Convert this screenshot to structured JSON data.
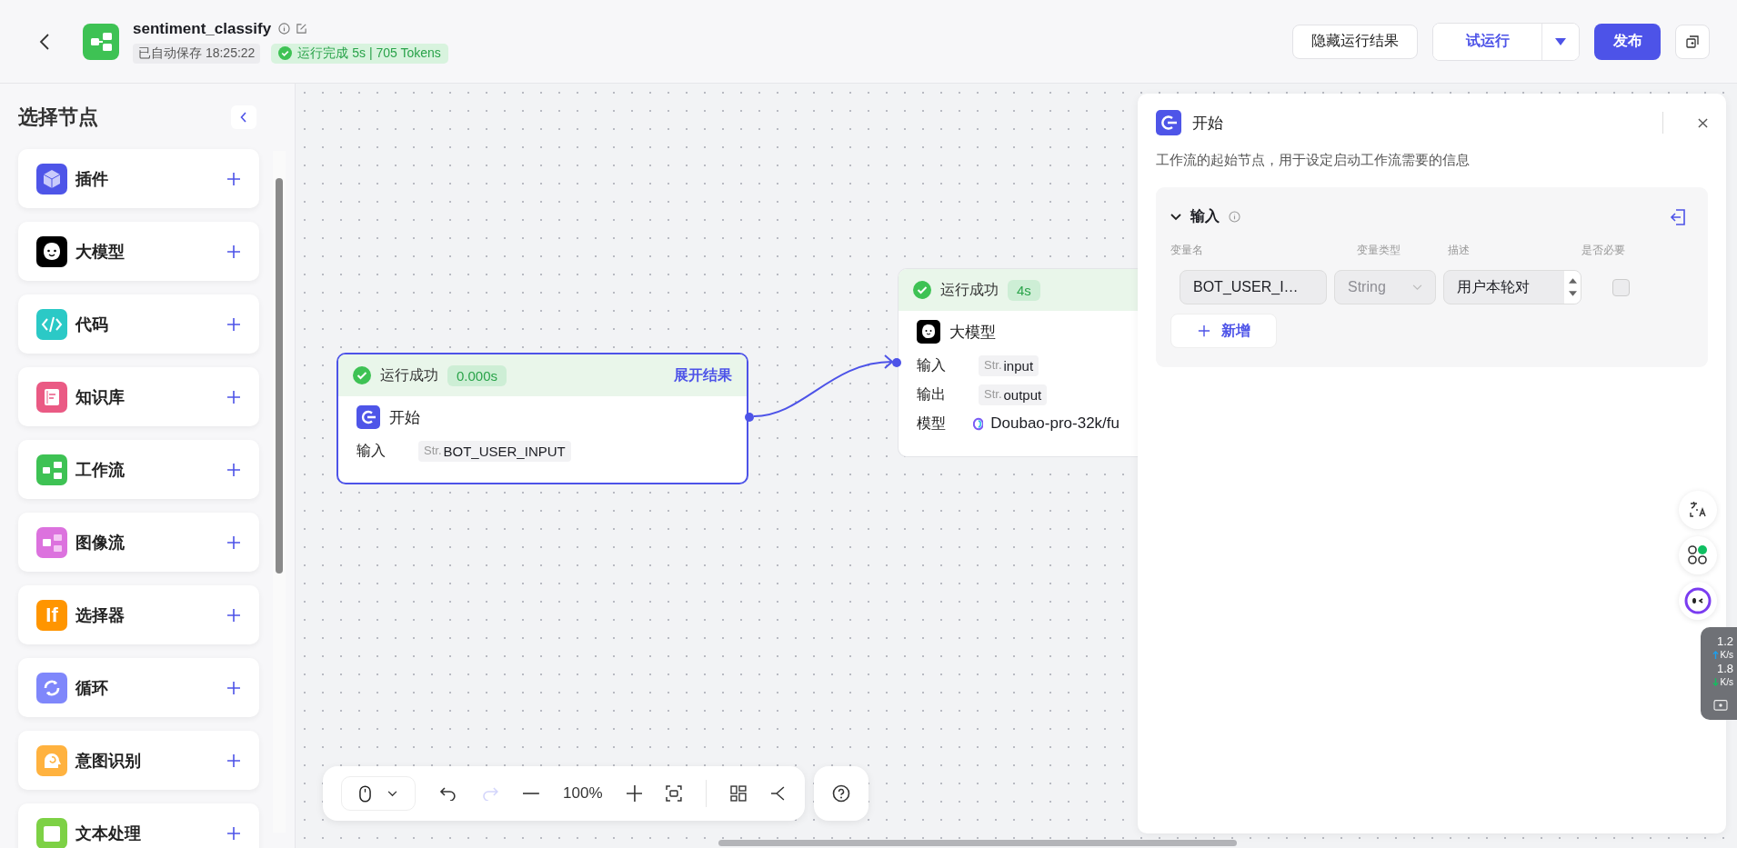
{
  "header": {
    "title": "sentiment_classify",
    "save_status": "已自动保存 18:25:22",
    "run_status": "运行完成 5s | 705 Tokens",
    "hide_button": "隐藏运行结果",
    "run_button": "试运行",
    "publish_button": "发布"
  },
  "sidebar": {
    "title": "选择节点",
    "items": [
      {
        "label": "插件",
        "kind": "plugin",
        "color": "#4e55e8"
      },
      {
        "label": "大模型",
        "kind": "llm",
        "color": "#000000"
      },
      {
        "label": "代码",
        "kind": "code",
        "color": "#2bc9c6"
      },
      {
        "label": "知识库",
        "kind": "knowledge",
        "color": "#ea5a84"
      },
      {
        "label": "工作流",
        "kind": "workflow",
        "color": "#3ec254"
      },
      {
        "label": "图像流",
        "kind": "imageflow",
        "color": "#dc72de"
      },
      {
        "label": "选择器",
        "kind": "selector",
        "color": "#ff9500",
        "icon_text": "If"
      },
      {
        "label": "循环",
        "kind": "loop",
        "color": "#7f87fb"
      },
      {
        "label": "意图识别",
        "kind": "intent",
        "color": "#ffb23f"
      },
      {
        "label": "文本处理",
        "kind": "text",
        "color": "#7dd145"
      }
    ]
  },
  "nodes": [
    {
      "kind": "start",
      "selected": true,
      "status": "运行成功",
      "time": "0.000s",
      "expand": "展开结果",
      "name": "开始",
      "rows": [
        {
          "kind": "var",
          "label": "输入",
          "type": "Str.",
          "value": "BOT_USER_INPUT"
        }
      ]
    },
    {
      "kind": "llm",
      "selected": false,
      "status": "运行成功",
      "time": "4s",
      "name": "大模型",
      "rows": [
        {
          "kind": "var",
          "label": "输入",
          "type": "Str.",
          "value": "input"
        },
        {
          "kind": "var",
          "label": "输出",
          "type": "Str.",
          "value": "output"
        },
        {
          "kind": "model",
          "label": "模型",
          "value": "Doubao-pro-32k/fu"
        }
      ]
    }
  ],
  "toolbar": {
    "zoom": "100%",
    "redo_disabled": true
  },
  "panel": {
    "title": "开始",
    "description": "工作流的起始节点，用于设定启动工作流需要的信息",
    "section": {
      "title": "输入",
      "expanded": true,
      "columns": [
        "变量名",
        "变量类型",
        "描述",
        "是否必要"
      ],
      "rows": [
        {
          "name": "BOT_USER_I…",
          "type": "String",
          "type_disabled": true,
          "description": "用户本轮对",
          "required": false
        }
      ],
      "add_button": "新增"
    }
  },
  "speed_widget": {
    "up": "1.2",
    "up_unit": "K/s",
    "down": "1.8",
    "down_unit": "K/s"
  }
}
